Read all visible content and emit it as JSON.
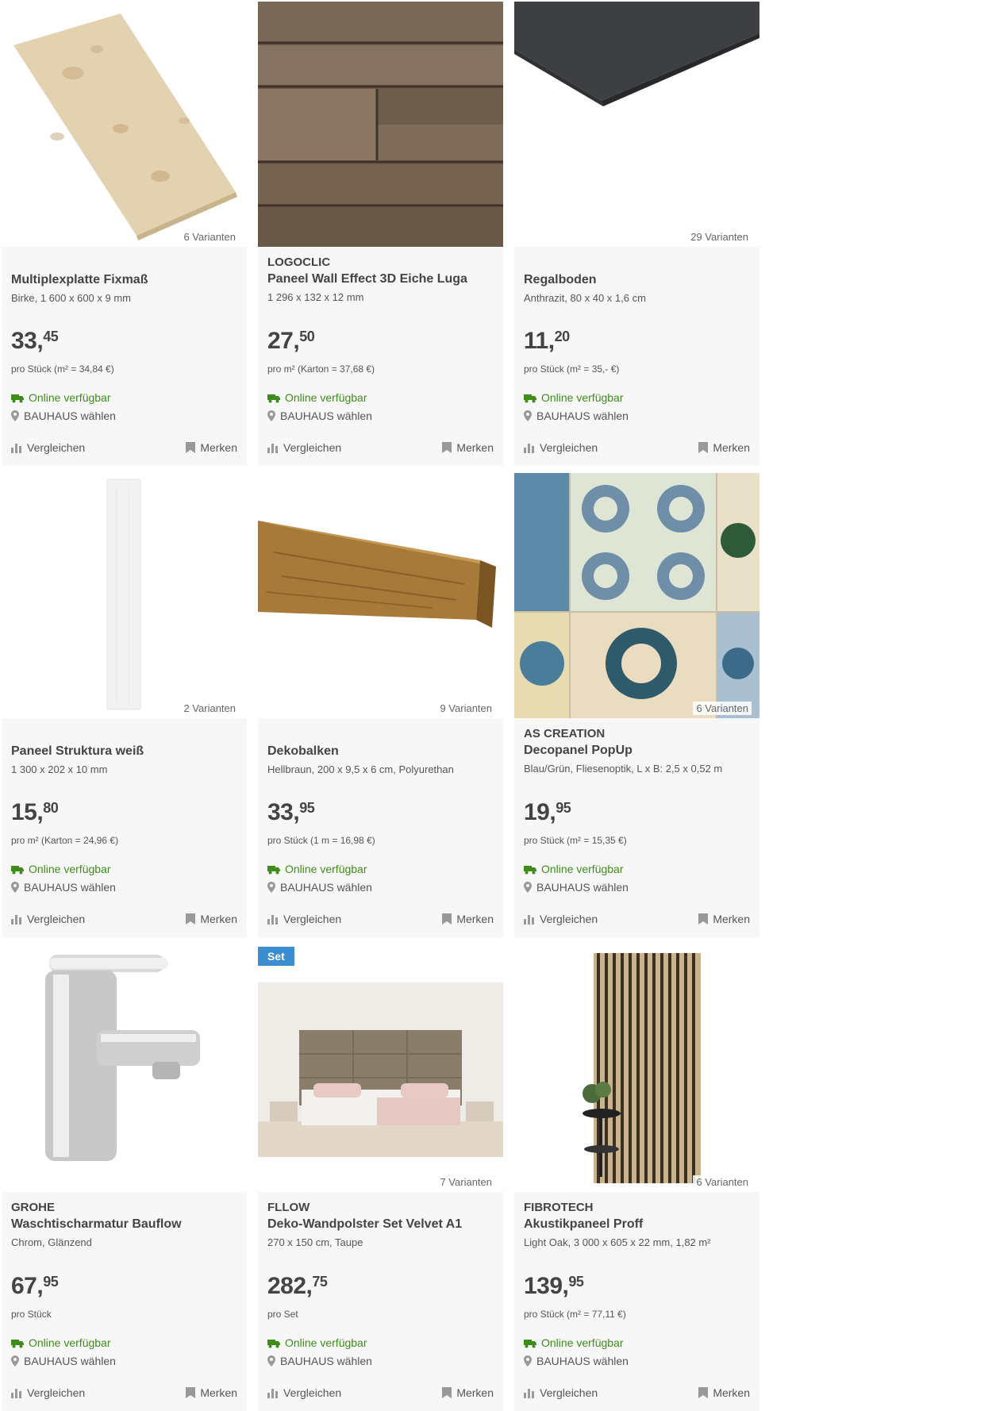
{
  "labels": {
    "online": "Online verfügbar",
    "store": "BAUHAUS wählen",
    "compare": "Vergleichen",
    "remember": "Merken"
  },
  "colors": {
    "card_bg": "#f7f7f7",
    "online_green": "#3f8c1a",
    "set_badge": "#3a8dd0",
    "icon_gray": "#999999"
  },
  "products": [
    {
      "brand": "",
      "title": "Multiplexplatte Fixmaß",
      "desc": "Birke, 1 600 x 600 x 9 mm",
      "price_main": "33,",
      "price_cents": "45",
      "unit": "pro Stück (m² = 34,84 €)",
      "variants": "6 Varianten",
      "badge": ""
    },
    {
      "brand": "LOGOCLIC",
      "title": "Paneel Wall Effect 3D Eiche Luga",
      "desc": "1 296 x 132 x 12 mm",
      "price_main": "27,",
      "price_cents": "50",
      "unit": "pro m² (Karton = 37,68 €)",
      "variants": "",
      "badge": ""
    },
    {
      "brand": "",
      "title": "Regalboden",
      "desc": "Anthrazit, 80 x 40 x 1,6 cm",
      "price_main": "11,",
      "price_cents": "20",
      "unit": "pro Stück (m² = 35,- €)",
      "variants": "29 Varianten",
      "badge": ""
    },
    {
      "brand": "",
      "title": "Paneel Struktura weiß",
      "desc": "1 300 x 202 x 10 mm",
      "price_main": "15,",
      "price_cents": "80",
      "unit": "pro m² (Karton = 24,96 €)",
      "variants": "2 Varianten",
      "badge": ""
    },
    {
      "brand": "",
      "title": "Dekobalken",
      "desc": "Hellbraun, 200 x 9,5 x 6 cm, Polyurethan",
      "price_main": "33,",
      "price_cents": "95",
      "unit": "pro Stück (1 m = 16,98 €)",
      "variants": "9 Varianten",
      "badge": ""
    },
    {
      "brand": "AS CREATION",
      "title": "Decopanel PopUp",
      "desc": "Blau/Grün, Fliesenoptik, L x B: 2,5 x 0,52 m",
      "price_main": "19,",
      "price_cents": "95",
      "unit": "pro Stück (m² = 15,35 €)",
      "variants": "6 Varianten",
      "badge": ""
    },
    {
      "brand": "GROHE",
      "title": "Waschtischarmatur Bauflow",
      "desc": "Chrom, Glänzend",
      "price_main": "67,",
      "price_cents": "95",
      "unit": "pro Stück",
      "variants": "",
      "badge": ""
    },
    {
      "brand": "FLLOW",
      "title": "Deko-Wandpolster Set Velvet A1",
      "desc": "270 x 150 cm, Taupe",
      "price_main": "282,",
      "price_cents": "75",
      "unit": "pro Set",
      "variants": "7 Varianten",
      "badge": "Set"
    },
    {
      "brand": "FIBROTECH",
      "title": "Akustikpaneel Proff",
      "desc": "Light Oak, 3 000 x 605 x 22 mm, 1,82 m²",
      "price_main": "139,",
      "price_cents": "95",
      "unit": "pro Stück (m² = 77,11 €)",
      "variants": "6 Varianten",
      "badge": ""
    }
  ]
}
